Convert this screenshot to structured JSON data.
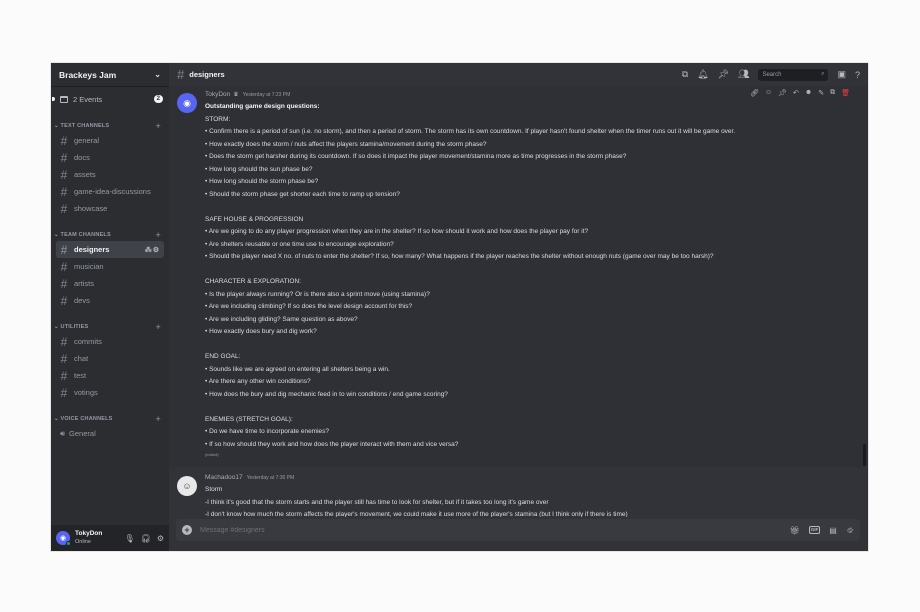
{
  "server": {
    "name": "Brackeys Jam",
    "chevron": "⌄"
  },
  "events": {
    "label": "2 Events",
    "count": "2"
  },
  "categories": {
    "text": "TEXT CHANNELS",
    "team": "TEAM CHANNELS",
    "utilities": "UTILITIES",
    "voice": "VOICE CHANNELS"
  },
  "text_channels": [
    "general",
    "docs",
    "assets",
    "game-idea-discussions",
    "showcase"
  ],
  "team_channels": [
    "designers",
    "musician",
    "artists",
    "devs"
  ],
  "utility_channels": [
    "commits",
    "chat",
    "test",
    "votings"
  ],
  "voice_channels": [
    "General"
  ],
  "user": {
    "name": "TokyDon",
    "status": "Online"
  },
  "channel": {
    "title": "designers"
  },
  "search": {
    "placeholder": "Search"
  },
  "messages": [
    {
      "author": "TokyDon",
      "time": "Yesterday at 7:23 PM",
      "lines": [
        "Outstanding game design questions:",
        "STORM:",
        "• Confirm there is a period of sun (i.e. no storm), and then a period of storm. The storm has its own countdown. If player hasn't found shelter when the timer runs out it will be game over.",
        "• How exactly does the storm / nuts affect the players stamina/movement during the storm phase?",
        "• Does the storm get harsher during its countdown. If so does it impact the player movement/stamina more as time progresses in the storm phase?",
        "• How long should the sun phase be?",
        "• How long should the storm phase be?",
        "• Should the storm phase get shorter each time to ramp up tension?",
        "",
        "SAFE HOUSE & PROGRESSION",
        "• Are we going to do any player progression when they are in the shelter? If so how should it work and how does the player pay for it?",
        "• Are shelters reusable or one time use to encourage exploration?",
        "• Should the player need X no. of nuts to enter the shelter? If so, how many? What happens if the player reaches the shelter without enough nuts (game over may be too harsh)?",
        "",
        "CHARACTER & EXPLORATION:",
        "• Is the player always running? Or is there also a sprint move (using stamina)?",
        "• Are we including climbing? If so does the level design account for this?",
        "• Are we including gliding? Same question as above?",
        "• How exactly does bury and dig work?",
        "",
        "END GOAL:",
        "• Sounds like we are agreed on entering all shelters being a win.",
        "• Are there any other win conditions?",
        "• How does the bury and dig mechanic feed in to win conditions / end game scoring?",
        "",
        "ENEMIES (STRETCH GOAL):",
        "• Do we have time to incorporate enemies?",
        "• If so how should they work and how does the player interact with them and vice versa?"
      ],
      "edited": "(edited)"
    },
    {
      "author": "Machadoo17",
      "time": "Yesterday at 7:36 PM",
      "lines": [
        "Storm",
        "-I think it's good that the storm starts and the player still has time to look for shelter, but if it takes too long it's game over",
        "-I don't know how much the storm affects the player's movement, we could make it use more of the player's stamina (but I think only if there is time)"
      ]
    }
  ],
  "composer": {
    "placeholder": "Message #designers"
  }
}
